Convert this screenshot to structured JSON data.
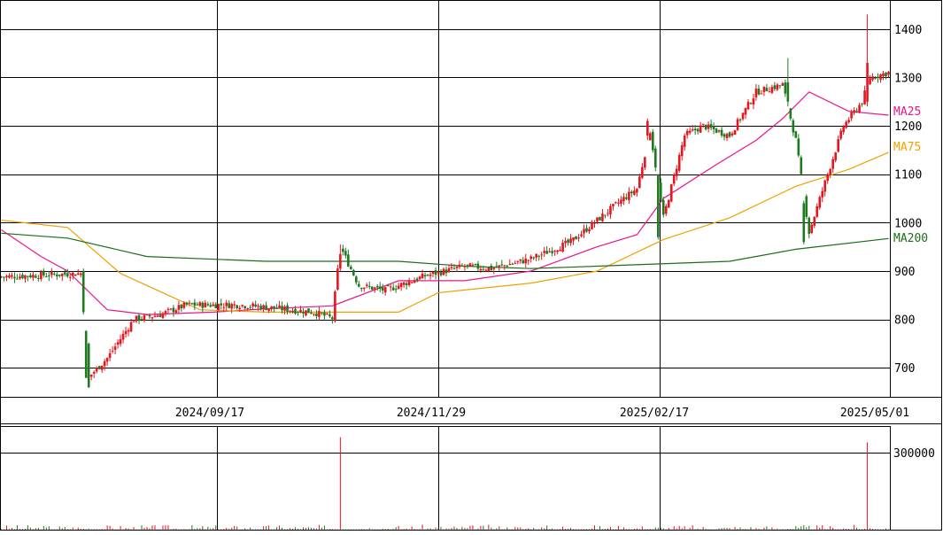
{
  "chart_data": [
    {
      "type": "candlestick",
      "y_ticks": [
        700,
        800,
        900,
        1000,
        1100,
        1200,
        1300,
        1400
      ],
      "ylim": [
        640,
        1460
      ],
      "x_tick_labels": [
        "2024/09/17",
        "2024/11/29",
        "2025/02/17",
        "2025/05/01"
      ],
      "series": [
        {
          "name": "MA25",
          "color": "#e8168c"
        },
        {
          "name": "MA75",
          "color": "#f0a000"
        },
        {
          "name": "MA200",
          "color": "#1a6e1a"
        }
      ],
      "colors": {
        "up": "#e8141e",
        "down": "#1f7a1f",
        "grid": "#000000"
      },
      "key_points": {
        "start_close": 888,
        "drop_low": 660,
        "september_high": 835,
        "november_spike_high": 955,
        "november_low": 840,
        "february_high": 1210,
        "march_high": 1340,
        "april_low": 960,
        "may_spike_high": 1430,
        "last_close": 1310
      },
      "ma_paths": {
        "MA25": [
          [
            0,
            985
          ],
          [
            15,
            930
          ],
          [
            25,
            900
          ],
          [
            40,
            820
          ],
          [
            55,
            810
          ],
          [
            80,
            815
          ],
          [
            100,
            822
          ],
          [
            125,
            828
          ],
          [
            150,
            880
          ],
          [
            175,
            880
          ],
          [
            200,
            900
          ],
          [
            225,
            950
          ],
          [
            240,
            975
          ],
          [
            250,
            1050
          ],
          [
            270,
            1120
          ],
          [
            285,
            1170
          ],
          [
            295,
            1215
          ],
          [
            305,
            1270
          ],
          [
            320,
            1230
          ],
          [
            335,
            1222
          ]
        ],
        "MA75": [
          [
            0,
            1005
          ],
          [
            25,
            990
          ],
          [
            45,
            895
          ],
          [
            75,
            820
          ],
          [
            100,
            815
          ],
          [
            150,
            815
          ],
          [
            165,
            855
          ],
          [
            200,
            875
          ],
          [
            225,
            900
          ],
          [
            250,
            965
          ],
          [
            275,
            1010
          ],
          [
            300,
            1075
          ],
          [
            320,
            1110
          ],
          [
            335,
            1145
          ]
        ],
        "MA200": [
          [
            0,
            978
          ],
          [
            25,
            968
          ],
          [
            55,
            930
          ],
          [
            100,
            920
          ],
          [
            150,
            920
          ],
          [
            175,
            910
          ],
          [
            200,
            905
          ],
          [
            235,
            912
          ],
          [
            275,
            920
          ],
          [
            300,
            945
          ],
          [
            335,
            967
          ]
        ]
      }
    },
    {
      "type": "bar",
      "y_ticks": [
        300000
      ],
      "ylim": [
        0,
        400000
      ],
      "spikes": [
        {
          "index": 128,
          "value": 360000
        },
        {
          "index": 327,
          "value": 340000
        }
      ],
      "bar_color": "#1f7a1f"
    }
  ]
}
